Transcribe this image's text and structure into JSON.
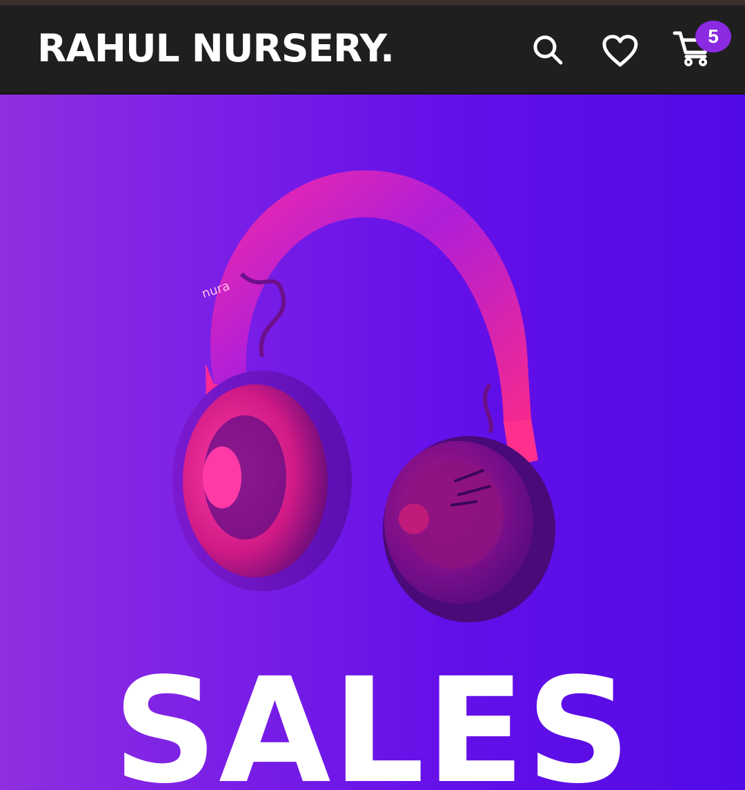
{
  "header": {
    "brand": "RAHUL NURSERY.",
    "icons": {
      "search": "search-icon",
      "wishlist": "heart-icon",
      "cart": "cart-icon"
    },
    "cart_count": "5"
  },
  "hero": {
    "headline": "SALES",
    "product_brand": "nura",
    "colors": {
      "gradient_start": "#8f2fe0",
      "gradient_end": "#520ae5",
      "product": "#ff1f8e"
    }
  },
  "colors": {
    "header_bg": "#1f1f1f",
    "badge": "#8a2be2",
    "text": "#ffffff"
  }
}
